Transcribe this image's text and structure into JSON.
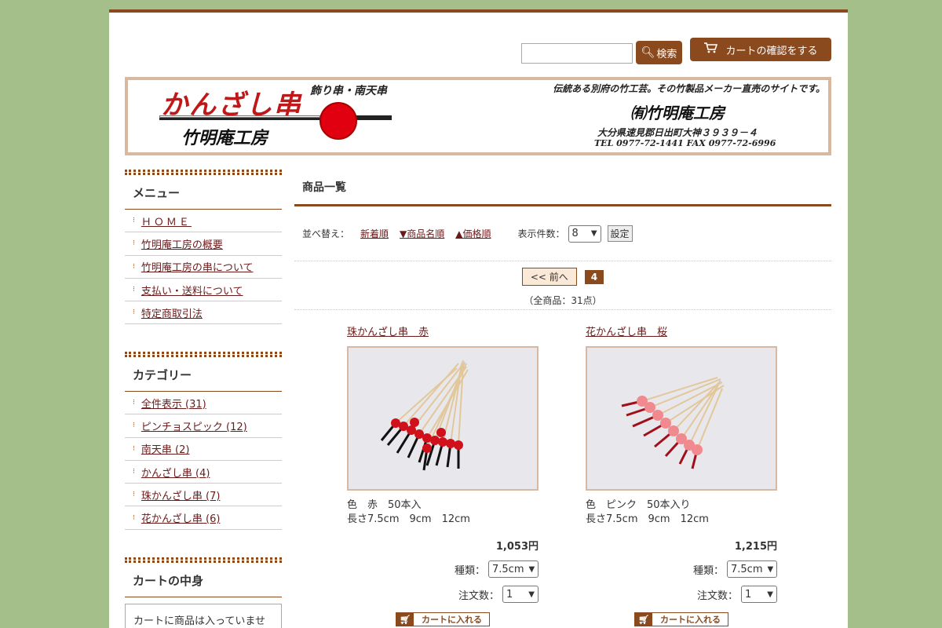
{
  "header": {
    "search_input_value": "",
    "search_button_label": "検索",
    "cart_button_label": "カートの確認をする"
  },
  "banner": {
    "brand_main": "かんざし串",
    "brand_sub": "飾り串・南天串",
    "brand_name": "竹明庵工房",
    "tagline": "伝統ある別府の竹工芸。その竹製品メーカー直売のサイトです。",
    "company": "㈲竹明庵工房",
    "address": "大分県速見郡日出町大神３９３９－４",
    "tel": "TEL 0977-72-1441  FAX 0977-72-6996"
  },
  "sidebar": {
    "menu_title": "メニュー",
    "menu_items": [
      {
        "label": "ＨＯＭＥ"
      },
      {
        "label": "竹明庵工房の概要"
      },
      {
        "label": "竹明庵工房の串について"
      },
      {
        "label": "支払い・送料について"
      },
      {
        "label": "特定商取引法"
      }
    ],
    "category_title": "カテゴリー",
    "category_items": [
      {
        "label": "全件表示 (31)"
      },
      {
        "label": "ピンチョスピック (12)"
      },
      {
        "label": "南天串 (2)"
      },
      {
        "label": "かんざし串 (4)"
      },
      {
        "label": "珠かんざし串 (7)"
      },
      {
        "label": "花かんざし串 (6)"
      }
    ],
    "cart_title": "カートの中身",
    "cart_text": "カートに商品は入っていませ"
  },
  "main": {
    "title": "商品一覧",
    "sort_label": "並べ替え：",
    "sort_links": [
      "新着順",
      "▼商品名順",
      "▲価格順"
    ],
    "count_label": "表示件数：",
    "count_value": "8",
    "set_button": "設定",
    "prev_label": "<< 前へ",
    "current_page": "4",
    "total_text": "（全商品：31点）"
  },
  "products": [
    {
      "title": "珠かんざし串　赤",
      "desc_line1": "色　赤　50本入",
      "desc_line2": "長さ7.5cm　9cm　12cm",
      "price": "1,053円",
      "kind_label": "種類：",
      "kind_value": "7.5cm",
      "qty_label": "注文数：",
      "qty_value": "1",
      "add_label": "カートに入れる"
    },
    {
      "title": "花かんざし串　桜",
      "desc_line1": "色　ピンク　50本入り",
      "desc_line2": "長さ7.5cm　9cm　12cm",
      "price": "1,215円",
      "kind_label": "種類：",
      "kind_value": "7.5cm",
      "qty_label": "注文数：",
      "qty_value": "1",
      "add_label": "カートに入れる"
    }
  ]
}
